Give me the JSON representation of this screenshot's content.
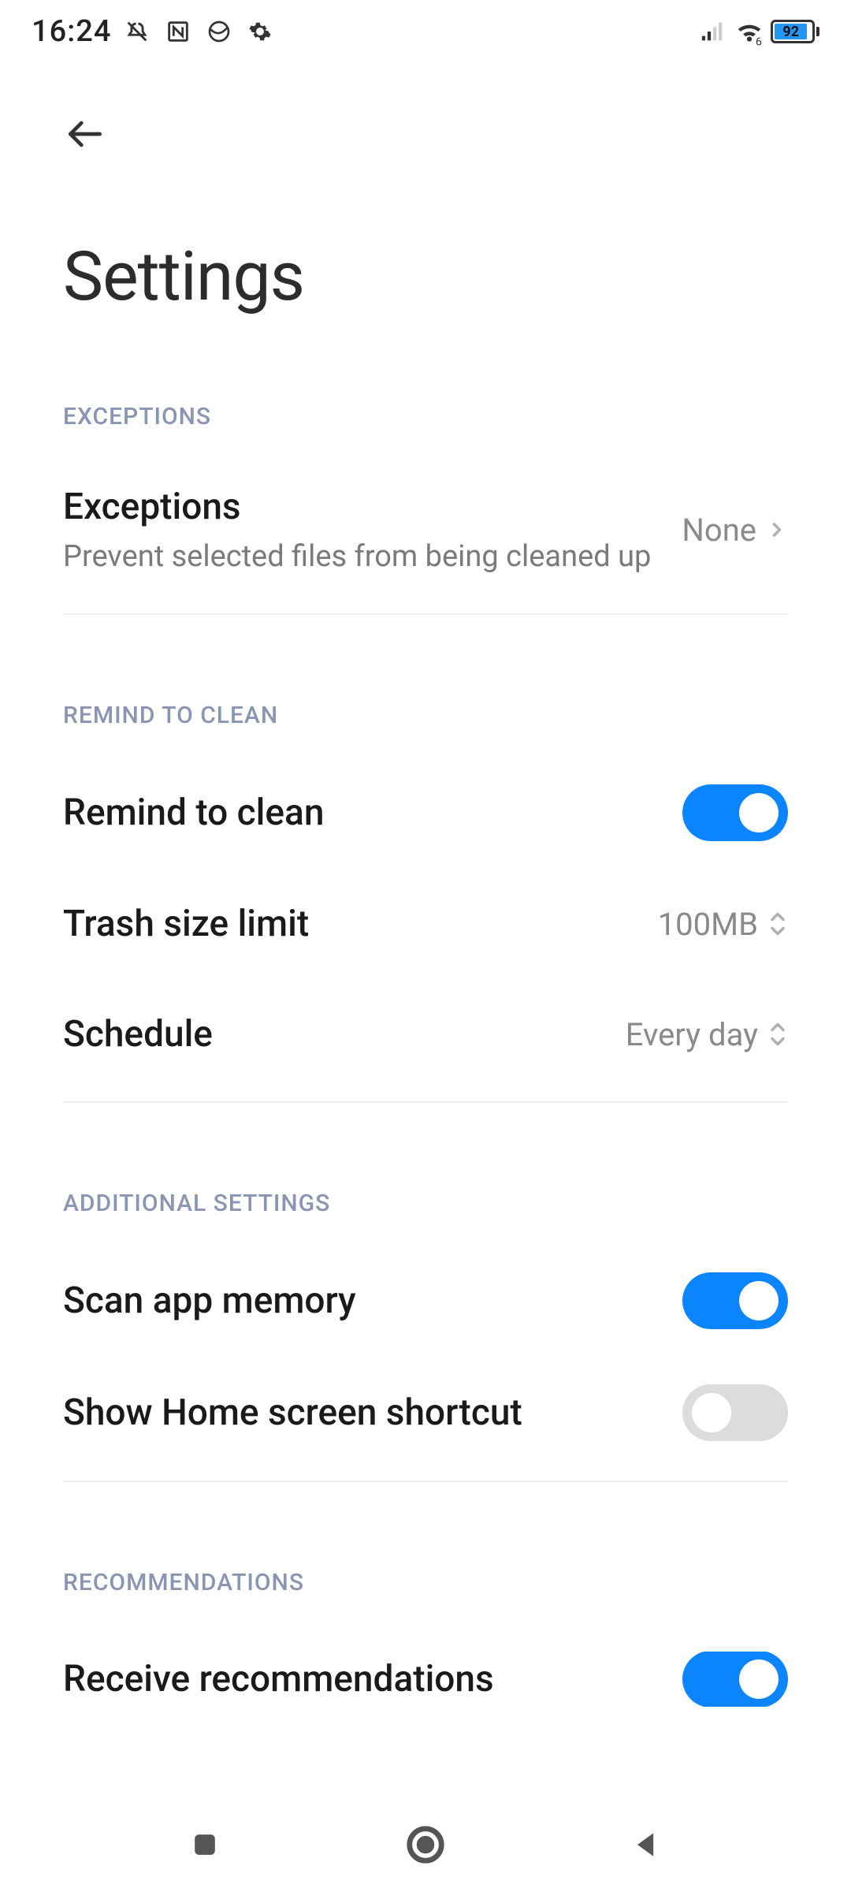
{
  "status": {
    "time": "16:24",
    "battery_level": "92"
  },
  "page": {
    "title": "Settings"
  },
  "sections": {
    "exceptions": {
      "header": "EXCEPTIONS",
      "item": {
        "title": "Exceptions",
        "subtitle": "Prevent selected files from being cleaned up",
        "value": "None"
      }
    },
    "remind": {
      "header": "REMIND TO CLEAN",
      "remind_to_clean": {
        "title": "Remind to clean",
        "enabled": true
      },
      "trash_size": {
        "title": "Trash size limit",
        "value": "100MB"
      },
      "schedule": {
        "title": "Schedule",
        "value": "Every day"
      }
    },
    "additional": {
      "header": "ADDITIONAL SETTINGS",
      "scan_memory": {
        "title": "Scan app memory",
        "enabled": true
      },
      "home_shortcut": {
        "title": "Show Home screen shortcut",
        "enabled": false
      }
    },
    "recommendations": {
      "header": "RECOMMENDATIONS",
      "receive": {
        "title": "Receive recommendations",
        "enabled": true
      }
    }
  }
}
